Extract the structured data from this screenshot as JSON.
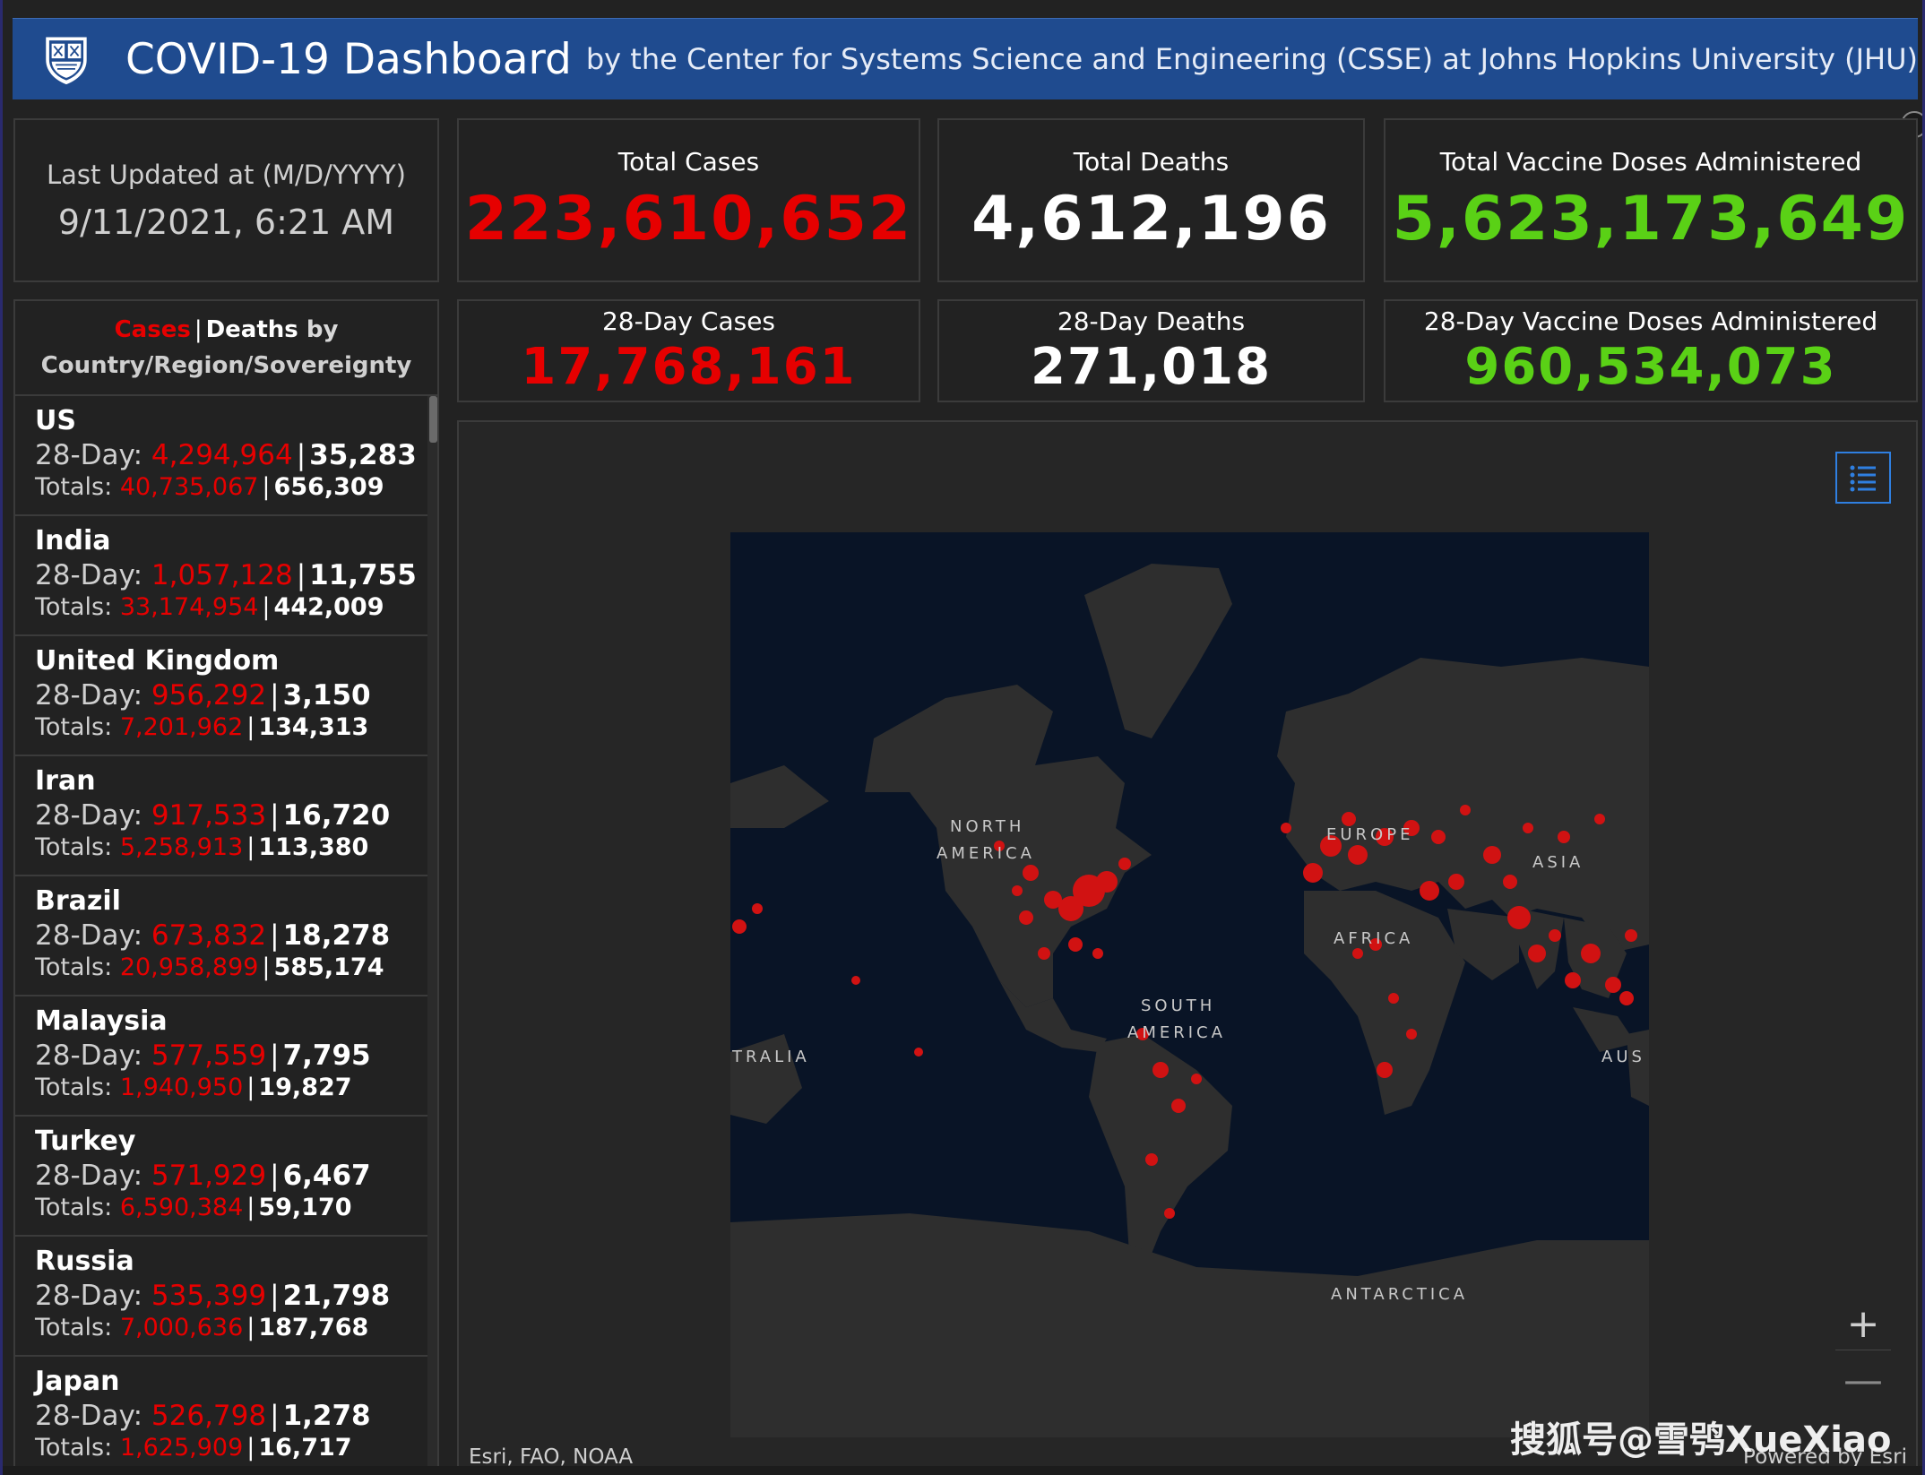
{
  "header": {
    "title": "COVID-19 Dashboard",
    "subtitle": "by the Center for Systems Science and Engineering (CSSE) at Johns Hopkins University (JHU)",
    "logo_icon": "jhu-shield-icon"
  },
  "last_updated": {
    "label": "Last Updated at (M/D/YYYY)",
    "value": "9/11/2021, 6:21 AM"
  },
  "totals": {
    "cases_label": "Total Cases",
    "cases_value": "223,610,652",
    "deaths_label": "Total Deaths",
    "deaths_value": "4,612,196",
    "vax_label": "Total Vaccine Doses Administered",
    "vax_value": "5,623,173,649"
  },
  "day28": {
    "cases_label": "28-Day Cases",
    "cases_value": "17,768,161",
    "deaths_label": "28-Day Deaths",
    "deaths_value": "271,018",
    "vax_label": "28-Day Vaccine Doses Administered",
    "vax_value": "960,534,073"
  },
  "list": {
    "header_cases": "Cases",
    "header_sep": "|",
    "header_deaths": "Deaths",
    "header_by": "by",
    "header_line2": "Country/Region/Sovereignty",
    "label_28": "28-Day:",
    "label_totals": "Totals:",
    "rows": [
      {
        "country": "US",
        "cases28": "4,294,964",
        "deaths28": "35,283",
        "cases_total": "40,735,067",
        "deaths_total": "656,309"
      },
      {
        "country": "India",
        "cases28": "1,057,128",
        "deaths28": "11,755",
        "cases_total": "33,174,954",
        "deaths_total": "442,009"
      },
      {
        "country": "United Kingdom",
        "cases28": "956,292",
        "deaths28": "3,150",
        "cases_total": "7,201,962",
        "deaths_total": "134,313"
      },
      {
        "country": "Iran",
        "cases28": "917,533",
        "deaths28": "16,720",
        "cases_total": "5,258,913",
        "deaths_total": "113,380"
      },
      {
        "country": "Brazil",
        "cases28": "673,832",
        "deaths28": "18,278",
        "cases_total": "20,958,899",
        "deaths_total": "585,174"
      },
      {
        "country": "Malaysia",
        "cases28": "577,559",
        "deaths28": "7,795",
        "cases_total": "1,940,950",
        "deaths_total": "19,827"
      },
      {
        "country": "Turkey",
        "cases28": "571,929",
        "deaths28": "6,467",
        "cases_total": "6,590,384",
        "deaths_total": "59,170"
      },
      {
        "country": "Russia",
        "cases28": "535,399",
        "deaths28": "21,798",
        "cases_total": "7,000,636",
        "deaths_total": "187,768"
      },
      {
        "country": "Japan",
        "cases28": "526,798",
        "deaths28": "1,278",
        "cases_total": "1,625,909",
        "deaths_total": "16,717"
      }
    ]
  },
  "map": {
    "labels": {
      "north_america_1": "NORTH",
      "north_america_2": "AMERICA",
      "europe": "EUROPE",
      "asia": "ASIA",
      "africa": "AFRICA",
      "south_america_1": "SOUTH",
      "south_america_2": "AMERICA",
      "australia_left": "TRALIA",
      "australia_right": "AUS",
      "antarctica": "ANTARCTICA"
    },
    "attribution": "Esri, FAO, NOAA",
    "powered_by": "Powered by Esri",
    "zoom_in": "+",
    "zoom_out": "—"
  },
  "watermark": "搜狐号@雪鸮XueXiao",
  "colors": {
    "header_bg": "#1f4b8f",
    "cases_red": "#e60000",
    "vaccine_green": "#5ad116",
    "ocean": "#091426",
    "land": "#2e2e2e"
  }
}
